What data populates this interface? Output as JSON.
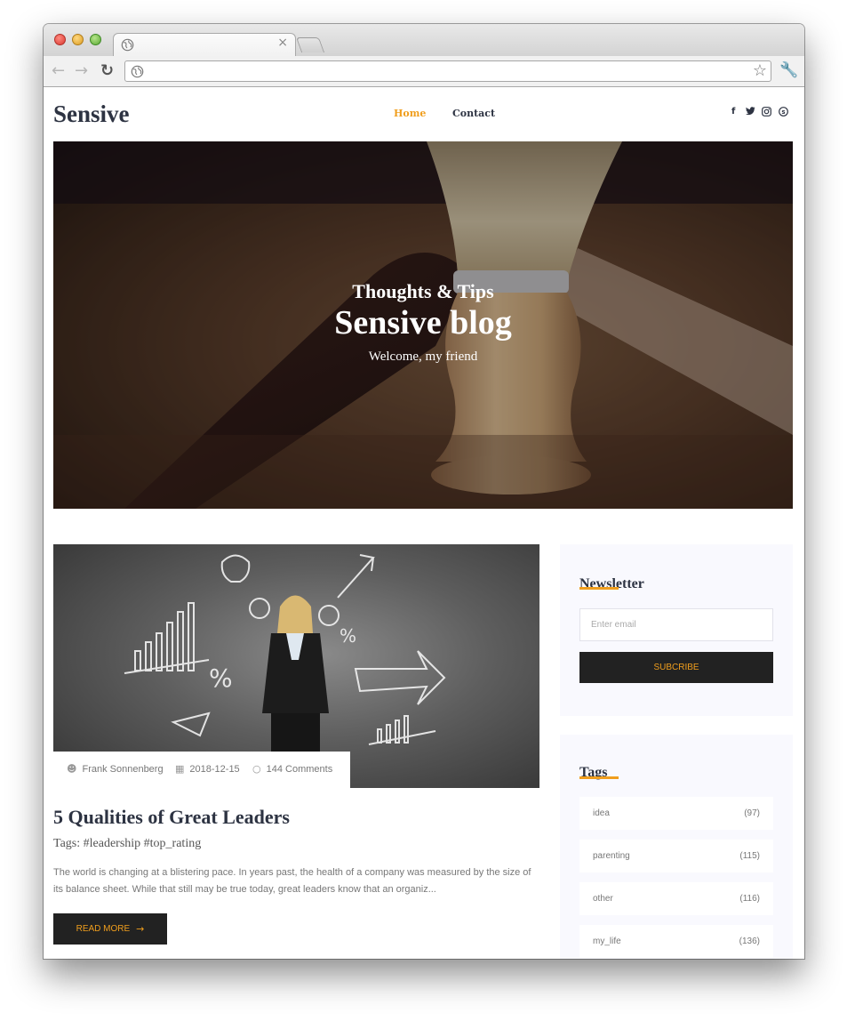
{
  "browser": {
    "tab_close": "×",
    "address_value": "",
    "icons": {
      "back": "arrow-left-icon",
      "forward": "arrow-right-icon",
      "reload": "reload-icon",
      "star": "star-icon",
      "wrench": "wrench-icon",
      "globe": "globe-icon"
    }
  },
  "header": {
    "logo": "Sensive",
    "nav": [
      {
        "label": "Home",
        "active": true
      },
      {
        "label": "Contact",
        "active": false
      }
    ],
    "social": [
      "f",
      "t",
      "ig",
      "s"
    ]
  },
  "hero": {
    "subtitle": "Thoughts & Tips",
    "title": "Sensive blog",
    "tagline": "Welcome, my friend"
  },
  "post": {
    "author": "Frank Sonnenberg",
    "date": "2018-12-15",
    "comments": "144 Comments",
    "title": "5 Qualities of Great Leaders",
    "tags": "Tags: #leadership #top_rating",
    "excerpt": "The world is changing at a blistering pace. In years past, the health of a company was measured by the size of its balance sheet. While that still may be true today, great leaders know that an organiz...",
    "read_more": "READ MORE"
  },
  "sidebar": {
    "newsletter": {
      "title": "Newsletter",
      "placeholder": "Enter email",
      "button": "SUBCRIBE"
    },
    "tags": {
      "title": "Tags",
      "items": [
        {
          "name": "idea",
          "count": "(97)"
        },
        {
          "name": "parenting",
          "count": "(115)"
        },
        {
          "name": "other",
          "count": "(116)"
        },
        {
          "name": "my_life",
          "count": "(136)"
        }
      ]
    }
  },
  "colors": {
    "accent": "#f09e1d",
    "heading": "#2d3342",
    "dark_button": "#222222",
    "widget_bg": "#f9f9fe"
  }
}
